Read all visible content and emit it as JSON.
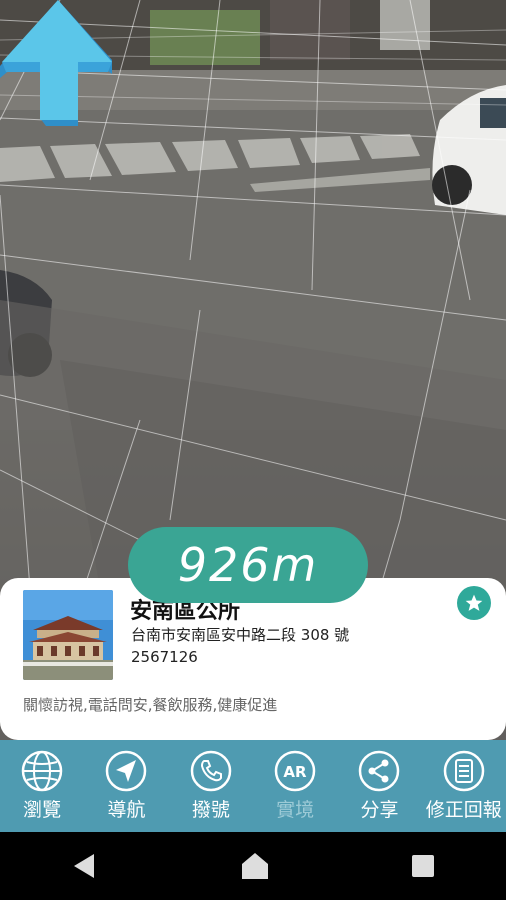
{
  "ar_view": {
    "distance": "926m"
  },
  "place": {
    "name": "安南區公所",
    "address": "台南市安南區安中路二段 308 號",
    "phone": "2567126",
    "services": "關懷訪視,電話問安,餐飲服務,健康促進"
  },
  "toolbar": {
    "items": [
      {
        "label": "瀏覽",
        "icon": "globe-icon"
      },
      {
        "label": "導航",
        "icon": "navigation-arrow-icon"
      },
      {
        "label": "撥號",
        "icon": "phone-icon"
      },
      {
        "label": "實境",
        "icon": "ar-icon",
        "disabled": true,
        "icon_text": "AR"
      },
      {
        "label": "分享",
        "icon": "share-icon"
      },
      {
        "label": "修正回報",
        "icon": "report-icon"
      }
    ]
  },
  "colors": {
    "accent": "#3aa594",
    "toolbar": "#4f9bb1",
    "arrow": "#5bc6e9"
  }
}
